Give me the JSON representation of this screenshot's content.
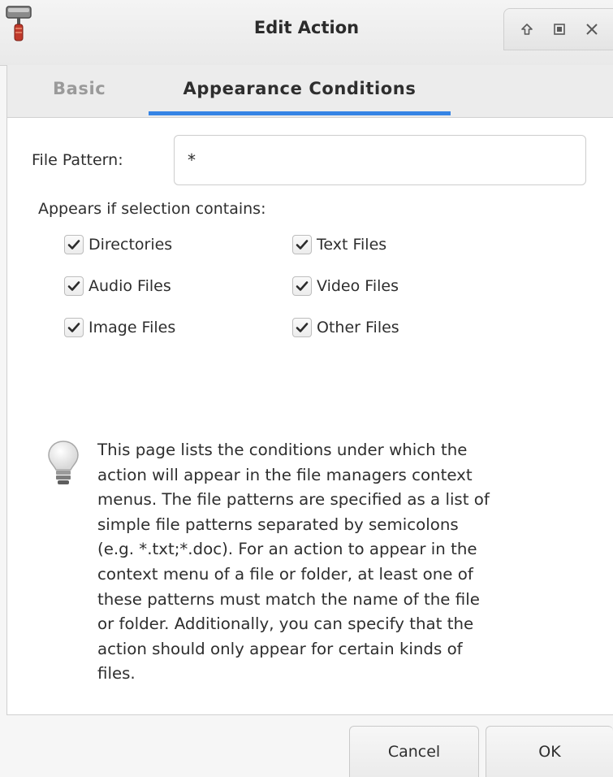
{
  "window": {
    "title": "Edit Action",
    "icon": "paint-roller-icon",
    "controls": [
      "maximize-icon",
      "restore-icon",
      "close-icon"
    ]
  },
  "tabs": [
    {
      "label": "Basic",
      "active": false
    },
    {
      "label": "Appearance Conditions",
      "active": true
    }
  ],
  "form": {
    "file_pattern_label": "File Pattern:",
    "file_pattern_value": "*",
    "appears_label": "Appears if selection contains:"
  },
  "checkboxes": [
    {
      "label": "Directories",
      "checked": true
    },
    {
      "label": "Text Files",
      "checked": true
    },
    {
      "label": "Audio Files",
      "checked": true
    },
    {
      "label": "Video Files",
      "checked": true
    },
    {
      "label": "Image Files",
      "checked": true
    },
    {
      "label": "Other Files",
      "checked": true
    }
  ],
  "info": {
    "icon": "lightbulb-icon",
    "lines": [
      "This page lists the conditions under which the",
      "action will appear in the file managers context",
      "menus. The file patterns are specified as a list of",
      "simple file patterns separated by semicolons",
      "(e.g. *.txt;*.doc). For an action to appear in the",
      "context menu of a file or folder, at least one of",
      "these patterns must match the name of the file",
      "or folder. Additionally, you can specify that the",
      "action should only appear for certain kinds of",
      "files."
    ]
  },
  "buttons": {
    "cancel": "Cancel",
    "ok": "OK"
  },
  "colors": {
    "accent": "#3584e4"
  }
}
